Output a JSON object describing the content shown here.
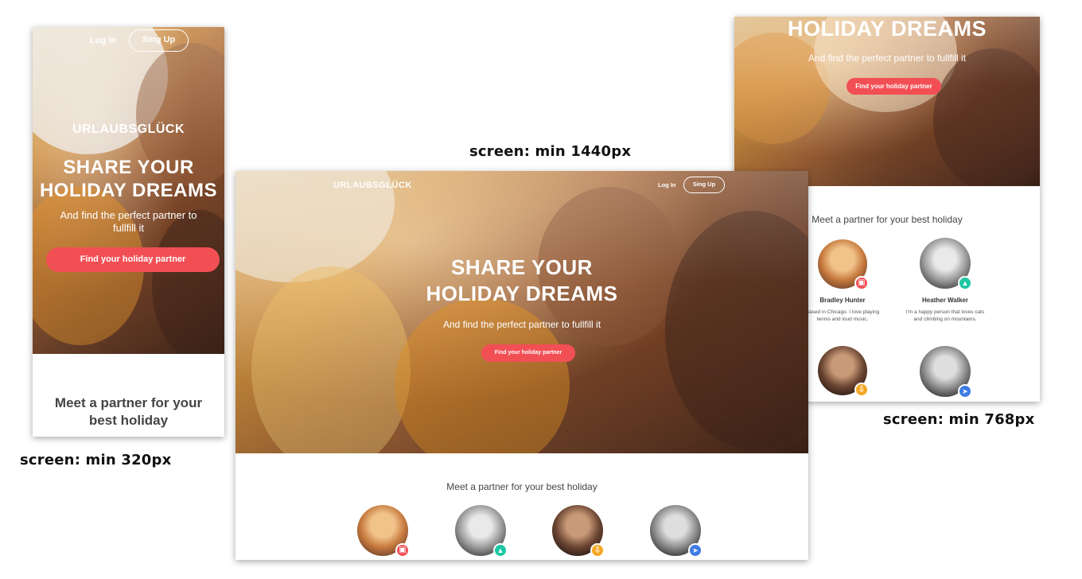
{
  "brand": "URLAUBSGLÜCK",
  "nav": {
    "login": "Log In",
    "signup": "Sing Up"
  },
  "hero": {
    "title_line1": "SHARE YOUR",
    "title_line2": "HOLIDAY DREAMS",
    "subtitle": "And find the perfect partner to fullfill it",
    "subtitle_line1": "And find the perfect partner to",
    "subtitle_line2": "fullfill it",
    "cta": "Find your holiday partner"
  },
  "section": {
    "title": "Meet a partner for your best holiday",
    "title_line1": "Meet a partner for your",
    "title_line2": "best holiday"
  },
  "profiles": [
    {
      "name": "Bradley Hunter",
      "bio_line1": "Based in Chicago. I love playing",
      "bio_line2": "tennis and loud music.",
      "badge_color": "#f24f55",
      "badge_icon": "camera-icon"
    },
    {
      "name": "Heather Walker",
      "bio_line1": "I'm a happy person that loves cats",
      "bio_line2": "and climbing on mountains.",
      "badge_color": "#1ec7a3",
      "badge_icon": "lock-icon"
    },
    {
      "name": "",
      "badge_color": "#f5a623",
      "badge_icon": "download-icon"
    },
    {
      "name": "",
      "badge_color": "#3e7be3",
      "badge_icon": "send-icon"
    }
  ],
  "captions": {
    "desktop": "screen: min 1440px",
    "tablet": "screen: min 768px",
    "mobile": "screen: min 320px"
  },
  "badge_glyphs": {
    "camera": "▣",
    "lock": "🔒︎",
    "download": "⇩",
    "send": "➤"
  }
}
